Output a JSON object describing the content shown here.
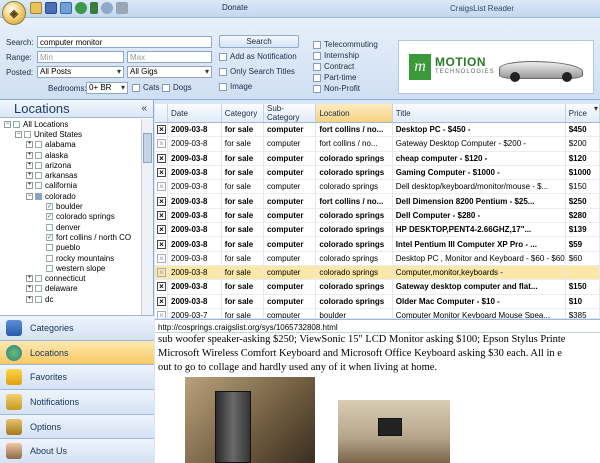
{
  "window": {
    "title": "CraigsList Reader",
    "donate": "Donate"
  },
  "search": {
    "search_label": "Search:",
    "search_value": "computer monitor",
    "range_label": "Range:",
    "min_placeholder": "Min",
    "max_placeholder": "Max",
    "posted_label": "Posted:",
    "posted_value": "All Posts",
    "gigs_value": "All Gigs",
    "bedrooms_label": "Bedrooms:",
    "bedrooms_value": "0+ BR",
    "cats": "Cats",
    "dogs": "Dogs",
    "search_button": "Search",
    "add_notification": "Add as Notification",
    "only_titles": "Only Search Titles",
    "image": "Image",
    "telecommuting": "Telecommuting",
    "internship": "Internship",
    "contract": "Contract",
    "parttime": "Part-time",
    "nonprofit": "Non-Profit"
  },
  "ad": {
    "brand": "MOTION",
    "sub": "TECHNOLOGIES"
  },
  "locations": {
    "title": "Locations",
    "tree": [
      {
        "label": "All Locations",
        "level": 0,
        "pm": "−"
      },
      {
        "label": "United States",
        "level": 1,
        "pm": "−"
      },
      {
        "label": "alabama",
        "level": 2,
        "pm": "+"
      },
      {
        "label": "alaska",
        "level": 2,
        "pm": "+"
      },
      {
        "label": "arizona",
        "level": 2,
        "pm": "+"
      },
      {
        "label": "arkansas",
        "level": 2,
        "pm": "+"
      },
      {
        "label": "california",
        "level": 2,
        "pm": "+"
      },
      {
        "label": "colorado",
        "level": 2,
        "pm": "−",
        "checked": "partial"
      },
      {
        "label": "boulder",
        "level": 3,
        "checked": "yes"
      },
      {
        "label": "colorado springs",
        "level": 3,
        "checked": "yes"
      },
      {
        "label": "denver",
        "level": 3
      },
      {
        "label": "fort collins / north CO",
        "level": 3,
        "checked": "yes"
      },
      {
        "label": "pueblo",
        "level": 3
      },
      {
        "label": "rocky mountains",
        "level": 3
      },
      {
        "label": "western slope",
        "level": 3
      },
      {
        "label": "connecticut",
        "level": 2,
        "pm": "+"
      },
      {
        "label": "delaware",
        "level": 2,
        "pm": "+"
      },
      {
        "label": "dc",
        "level": 2,
        "pm": "+"
      }
    ]
  },
  "nav": [
    "Categories",
    "Locations",
    "Favorites",
    "Notifications",
    "Options",
    "About Us"
  ],
  "grid": {
    "columns": [
      "Date",
      "Category",
      "Sub-Category",
      "Location",
      "Title",
      "Price"
    ],
    "rows": [
      {
        "date": "2009-03-8",
        "cat": "for sale",
        "sub": "computer",
        "loc": "fort collins / no...",
        "title": "Desktop PC - $450 -",
        "price": "$450",
        "bold": true
      },
      {
        "date": "2009-03-8",
        "cat": "for sale",
        "sub": "computer",
        "loc": "fort collins / no...",
        "title": "Gateway Desktop Computer - $200 -",
        "price": "$200",
        "bold": false
      },
      {
        "date": "2009-03-8",
        "cat": "for sale",
        "sub": "computer",
        "loc": "colorado springs",
        "title": "cheap computer - $120 -",
        "price": "$120",
        "bold": true
      },
      {
        "date": "2009-03-8",
        "cat": "for sale",
        "sub": "computer",
        "loc": "colorado springs",
        "title": "Gaming Computer - $1000 -",
        "price": "$1000",
        "bold": true
      },
      {
        "date": "2009-03-8",
        "cat": "for sale",
        "sub": "computer",
        "loc": "colorado springs",
        "title": "Dell desktop/keyboard/monitor/mouse - $...",
        "price": "$150",
        "bold": false
      },
      {
        "date": "2009-03-8",
        "cat": "for sale",
        "sub": "computer",
        "loc": "fort collins / no...",
        "title": "Dell Dimension 8200 Pentium - $25...",
        "price": "$250",
        "bold": true
      },
      {
        "date": "2009-03-8",
        "cat": "for sale",
        "sub": "computer",
        "loc": "colorado springs",
        "title": "Dell Computer - $280 -",
        "price": "$280",
        "bold": true
      },
      {
        "date": "2009-03-8",
        "cat": "for sale",
        "sub": "computer",
        "loc": "colorado springs",
        "title": "HP DESKTOP,PENT4-2.66GHZ,17\"...",
        "price": "$139",
        "bold": true
      },
      {
        "date": "2009-03-8",
        "cat": "for sale",
        "sub": "computer",
        "loc": "colorado springs",
        "title": "Intel Pentium III Computer XP Pro - ...",
        "price": "$59",
        "bold": true
      },
      {
        "date": "2009-03-8",
        "cat": "for sale",
        "sub": "computer",
        "loc": "colorado springs",
        "title": "Desktop PC , Monitor and Keyboard - $60 - $60",
        "price": "$60",
        "bold": false
      },
      {
        "date": "2009-03-8",
        "cat": "for sale",
        "sub": "computer",
        "loc": "colorado springs",
        "title": "Computer,monitor,keyboards -",
        "price": "",
        "bold": false,
        "selected": true
      },
      {
        "date": "2009-03-8",
        "cat": "for sale",
        "sub": "computer",
        "loc": "colorado springs",
        "title": "Gateway desktop computer and flat...",
        "price": "$150",
        "bold": true
      },
      {
        "date": "2009-03-8",
        "cat": "for sale",
        "sub": "computer",
        "loc": "colorado springs",
        "title": "Older Mac Computer - $10 -",
        "price": "$10",
        "bold": true
      },
      {
        "date": "2009-03-7",
        "cat": "for sale",
        "sub": "computer",
        "loc": "boulder",
        "title": "Computer Monitor Keyboard Mouse Spea...",
        "price": "$385",
        "bold": false
      }
    ]
  },
  "detail": {
    "url": "http://cosprings.craigslist.org/sys/1065732808.html",
    "lines": [
      "sub woofer speaker-asking $250; ViewSonic 15\" LCD Monitor asking $100; Epson Stylus Printe",
      "Microsoft Wireless Comfort Keyboard and Microsoft Office Keyboard asking $30 each. All in e",
      "out to go to collage and hardly used any of it when living at home."
    ]
  }
}
